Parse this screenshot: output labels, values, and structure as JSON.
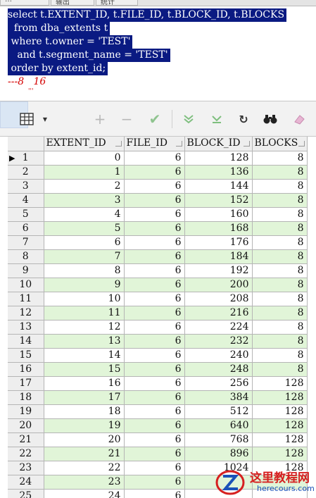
{
  "tabs": [
    {
      "label": "…"
    },
    {
      "label": "输出"
    },
    {
      "label": "统计"
    }
  ],
  "editor": {
    "lines": [
      "select t.EXTENT_ID, t.FILE_ID, t.BLOCK_ID, t.BLOCKS",
      "  from dba_extents t",
      " where t.owner = 'TEST'",
      "   and t.segment_name = 'TEST'",
      " order by extent_id;"
    ],
    "comment": "---8   16",
    "comment_clip": "'''"
  },
  "toolbar": {
    "icons": [
      "grid-icon",
      "dropdown-arrow-icon",
      "plus-icon",
      "minus-icon",
      "check-icon",
      "first-record-icon",
      "last-record-icon",
      "refresh-icon",
      "binoculars-icon",
      "eraser-icon"
    ],
    "add_label": "+",
    "remove_label": "−",
    "post_label": "✔",
    "refresh_label": "↻",
    "find_label": "🔍"
  },
  "grid": {
    "columns": [
      "EXTENT_ID",
      "FILE_ID",
      "BLOCK_ID",
      "BLOCKS"
    ],
    "rows": [
      [
        "1",
        "0",
        "6",
        "128",
        "8"
      ],
      [
        "2",
        "1",
        "6",
        "136",
        "8"
      ],
      [
        "3",
        "2",
        "6",
        "144",
        "8"
      ],
      [
        "4",
        "3",
        "6",
        "152",
        "8"
      ],
      [
        "5",
        "4",
        "6",
        "160",
        "8"
      ],
      [
        "6",
        "5",
        "6",
        "168",
        "8"
      ],
      [
        "7",
        "6",
        "6",
        "176",
        "8"
      ],
      [
        "8",
        "7",
        "6",
        "184",
        "8"
      ],
      [
        "9",
        "8",
        "6",
        "192",
        "8"
      ],
      [
        "10",
        "9",
        "6",
        "200",
        "8"
      ],
      [
        "11",
        "10",
        "6",
        "208",
        "8"
      ],
      [
        "12",
        "11",
        "6",
        "216",
        "8"
      ],
      [
        "13",
        "12",
        "6",
        "224",
        "8"
      ],
      [
        "14",
        "13",
        "6",
        "232",
        "8"
      ],
      [
        "15",
        "14",
        "6",
        "240",
        "8"
      ],
      [
        "16",
        "15",
        "6",
        "248",
        "8"
      ],
      [
        "17",
        "16",
        "6",
        "256",
        "128"
      ],
      [
        "18",
        "17",
        "6",
        "384",
        "128"
      ],
      [
        "19",
        "18",
        "6",
        "512",
        "128"
      ],
      [
        "20",
        "19",
        "6",
        "640",
        "128"
      ],
      [
        "21",
        "20",
        "6",
        "768",
        "128"
      ],
      [
        "22",
        "21",
        "6",
        "896",
        "128"
      ],
      [
        "23",
        "22",
        "6",
        "1024",
        "128"
      ],
      [
        "24",
        "23",
        "6",
        "",
        ""
      ],
      [
        "25",
        "24",
        "6",
        "",
        ""
      ]
    ],
    "current_row": 1
  },
  "colors": {
    "selection": "#0a1a82",
    "alt_row": "#e1f5d8",
    "comment": "#d40000"
  },
  "watermark": {
    "text": "这里教程网",
    "url": "herecours.com"
  }
}
